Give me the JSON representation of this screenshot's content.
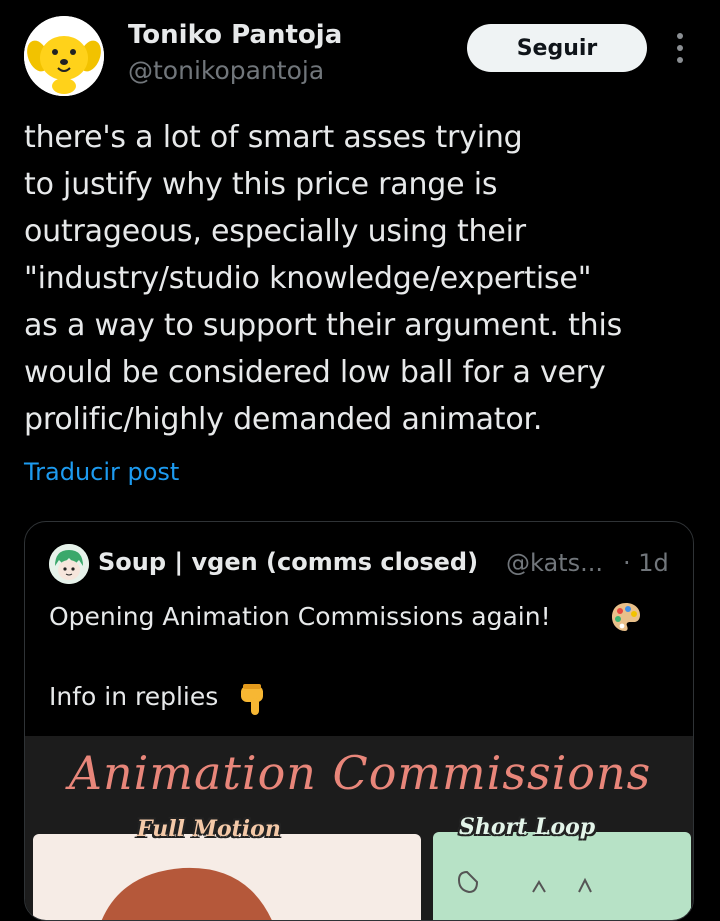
{
  "author": {
    "name": "Toniko Pantoja",
    "handle": "@tonikopantoja"
  },
  "actions": {
    "follow_label": "Seguir"
  },
  "post": {
    "text": "there's a lot of smart asses trying\nto justify why this price range is\noutrageous, especially using their\n\"industry/studio knowledge/expertise\"\nas a way to support their argument. this\nwould be considered low ball for a very\nprolific/highly demanded animator.",
    "translate_label": "Traducir post"
  },
  "quote": {
    "author_name": "Soup | vgen (comms closed)",
    "author_handle": "@kats...",
    "time": "· 1d",
    "line1": "Opening Animation Commissions again!",
    "line2": "Info in replies",
    "line1_emoji": "palette-icon",
    "line2_emoji": "pointing-down-icon"
  },
  "media": {
    "title": "Animation Commissions",
    "label_full": "Full Motion",
    "label_short": "Short Loop"
  },
  "colors": {
    "background": "#000000",
    "text_primary": "#e7e9ea",
    "text_secondary": "#71767b",
    "link": "#1d9bf0",
    "follow_bg": "#eff3f4",
    "border": "#2f3336",
    "media_title": "#e8867a"
  }
}
